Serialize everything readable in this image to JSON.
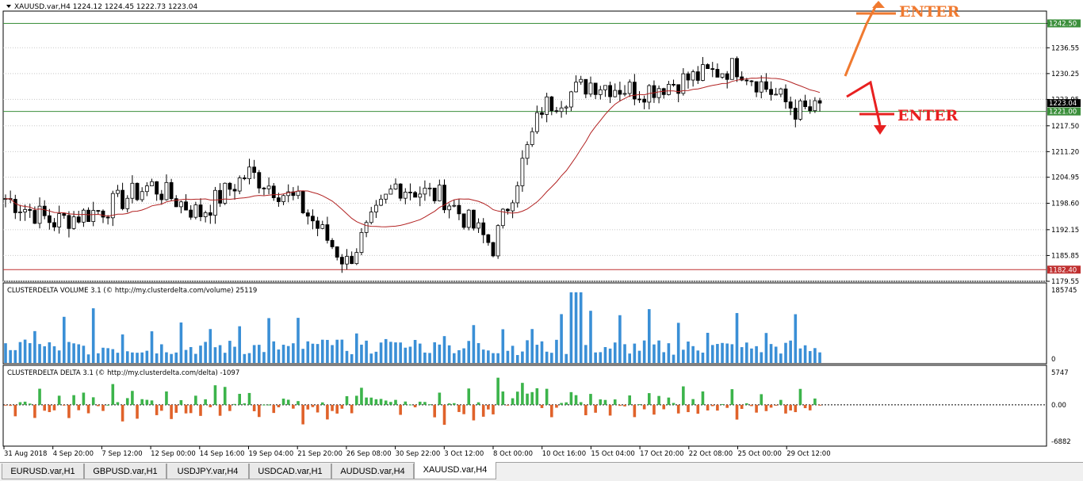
{
  "header": {
    "symbol": "XAUUSD.var,H4",
    "ohlc": "1224.12 1224.45 1222.73 1223.04"
  },
  "price_panel": {
    "y_ticks": [
      "1242.50",
      "1236.55",
      "1230.25",
      "1223.95",
      "1217.50",
      "1211.20",
      "1204.95",
      "1198.60",
      "1192.15",
      "1185.85",
      "1179.55"
    ],
    "levels": [
      {
        "label": "1242.50",
        "color": "#3b8f3b"
      },
      {
        "label": "1221.00",
        "color": "#3b8f3b"
      },
      {
        "label": "1182.40",
        "color": "#c03030"
      }
    ],
    "current_price": "1223.04",
    "annotations": [
      {
        "text": "ENTER",
        "color": "#f07a30",
        "direction": "up"
      },
      {
        "text": "ENTER",
        "color": "#e82020",
        "direction": "down"
      }
    ]
  },
  "volume_panel": {
    "title": "CLUSTERDELTA VOLUME 3.1 (© http://my.clusterdelta.com/volume) 25119",
    "y_ticks": [
      "185745",
      "0"
    ],
    "color": "#3a8fd6"
  },
  "delta_panel": {
    "title": "CLUSTERDELTA DELTA 3.1 (© http://my.clusterdelta.com/delta) -1097",
    "y_ticks": [
      "5747",
      "0.00",
      "-6882"
    ],
    "pos_color": "#3cb44b",
    "neg_color": "#e0622a"
  },
  "x_labels": [
    "31 Aug 2018",
    "4 Sep 20:00",
    "7 Sep 12:00",
    "12 Sep 00:00",
    "14 Sep 16:00",
    "19 Sep 04:00",
    "21 Sep 20:00",
    "26 Sep 08:00",
    "30 Sep 22:00",
    "3 Oct 12:00",
    "8 Oct 00:00",
    "10 Oct 16:00",
    "15 Oct 04:00",
    "17 Oct 20:00",
    "22 Oct 08:00",
    "25 Oct 00:00",
    "29 Oct 12:00"
  ],
  "tabs": [
    {
      "label": "EURUSD.var,H1",
      "active": false
    },
    {
      "label": "GBPUSD.var,H1",
      "active": false
    },
    {
      "label": "USDJPY.var,H4",
      "active": false
    },
    {
      "label": "USDCAD.var,H1",
      "active": false
    },
    {
      "label": "AUDUSD.var,H4",
      "active": false
    },
    {
      "label": "XAUUSD.var,H4",
      "active": true
    }
  ],
  "chart_data": {
    "type": "candlestick",
    "symbol": "XAUUSD.var,H4",
    "ylim": [
      1179.55,
      1245.5
    ],
    "close_anchors": [
      {
        "x": "31 Aug 2018",
        "y": 1200
      },
      {
        "x": "4 Sep 20:00",
        "y": 1194
      },
      {
        "x": "7 Sep 12:00",
        "y": 1197
      },
      {
        "x": "12 Sep 00:00",
        "y": 1203
      },
      {
        "x": "14 Sep 16:00",
        "y": 1196
      },
      {
        "x": "19 Sep 04:00",
        "y": 1206
      },
      {
        "x": "21 Sep 20:00",
        "y": 1199
      },
      {
        "x": "26 Sep 08:00",
        "y": 1184
      },
      {
        "x": "30 Sep 22:00",
        "y": 1203
      },
      {
        "x": "3 Oct 12:00",
        "y": 1200
      },
      {
        "x": "8 Oct 00:00",
        "y": 1188
      },
      {
        "x": "10 Oct 16:00",
        "y": 1222
      },
      {
        "x": "15 Oct 04:00",
        "y": 1228
      },
      {
        "x": "17 Oct 20:00",
        "y": 1226
      },
      {
        "x": "22 Oct 08:00",
        "y": 1229
      },
      {
        "x": "25 Oct 00:00",
        "y": 1232
      },
      {
        "x": "29 Oct 12:00",
        "y": 1223
      }
    ],
    "moving_average_color": "#b22222",
    "volume_range": [
      0,
      185745
    ],
    "delta_range": [
      -6882,
      5747
    ]
  }
}
